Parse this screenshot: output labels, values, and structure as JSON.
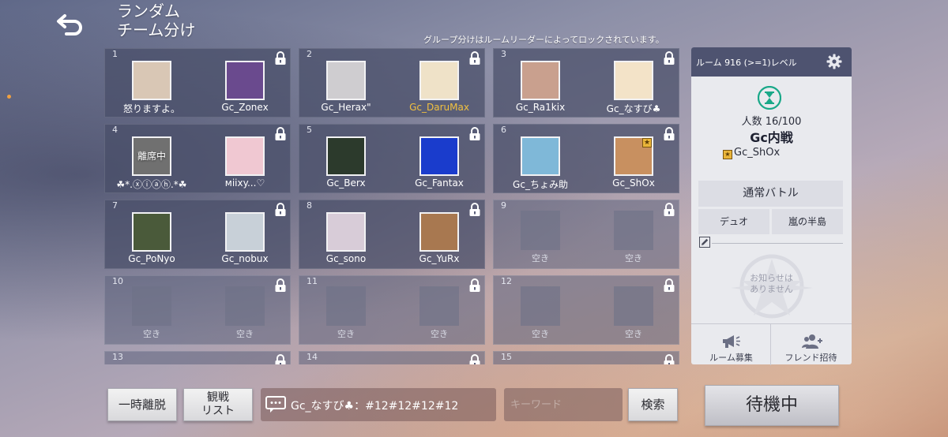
{
  "header": {
    "title_line1": "ランダム",
    "title_line2": "チーム分け",
    "lock_notice": "グループ分けはルームリーダーによってロックされています。"
  },
  "icons": {
    "back": "back-arrow-icon",
    "lock": "lock-icon",
    "gear": "gear-icon",
    "hourglass": "hourglass-icon",
    "edit": "edit-icon",
    "chat": "chat-bubble-icon",
    "megaphone": "megaphone-icon",
    "friend_add": "add-friend-icon"
  },
  "colors": {
    "leader_name": "#f0c040",
    "panel_header": "#4e5370",
    "hourglass": "#19a888"
  },
  "groups": [
    {
      "num": "1",
      "members": [
        {
          "name": "怒りますよ。",
          "color": "#d9c7b5"
        },
        {
          "name": "Gc_Zonex",
          "color": "#6a4a8e"
        }
      ]
    },
    {
      "num": "2",
      "members": [
        {
          "name": "Gc_Herax\"",
          "color": "#cfcdd0"
        },
        {
          "name": "Gc_DaruMax",
          "color": "#efe2c8",
          "leader": true
        }
      ]
    },
    {
      "num": "3",
      "members": [
        {
          "name": "Gc_Ra1kix",
          "color": "#c9a08e"
        },
        {
          "name": "Gc_なすび♣",
          "color": "#f3e3c8"
        }
      ]
    },
    {
      "num": "4",
      "members": [
        {
          "name": "☘*.ⓧⓘⓐⓗ.*☘",
          "color": "#707070",
          "overlay": "離席中"
        },
        {
          "name": "ᴍiixy...♡",
          "color": "#f0c8d2"
        }
      ]
    },
    {
      "num": "5",
      "members": [
        {
          "name": "Gc_Berx",
          "color": "#2c3a2c"
        },
        {
          "name": "Gc_Fantax",
          "color": "#1a3ccc"
        }
      ]
    },
    {
      "num": "6",
      "members": [
        {
          "name": "Gc_ちょみ助",
          "color": "#7fb8d8"
        },
        {
          "name": "Gc_ShOx",
          "color": "#c89060",
          "star": true
        }
      ]
    },
    {
      "num": "7",
      "members": [
        {
          "name": "Gc_PoNyo",
          "color": "#4a5a3a"
        },
        {
          "name": "Gc_nobux",
          "color": "#c8d0d8"
        }
      ]
    },
    {
      "num": "8",
      "members": [
        {
          "name": "Gc_sono",
          "color": "#d8ccd8"
        },
        {
          "name": "Gc_YuRx",
          "color": "#a87850"
        }
      ]
    },
    {
      "num": "9",
      "members": [
        {
          "name": "空き",
          "empty": true
        },
        {
          "name": "空き",
          "empty": true
        }
      ]
    },
    {
      "num": "10",
      "members": [
        {
          "name": "空き",
          "empty": true
        },
        {
          "name": "空き",
          "empty": true
        }
      ]
    },
    {
      "num": "11",
      "members": [
        {
          "name": "空き",
          "empty": true
        },
        {
          "name": "空き",
          "empty": true
        }
      ]
    },
    {
      "num": "12",
      "members": [
        {
          "name": "空き",
          "empty": true
        },
        {
          "name": "空き",
          "empty": true
        }
      ]
    },
    {
      "num": "13",
      "members": []
    },
    {
      "num": "14",
      "members": []
    },
    {
      "num": "15",
      "members": []
    }
  ],
  "room": {
    "label": "ルーム 916 (>=1)レベル",
    "count": "人数 16/100",
    "name": "Gc内戦",
    "host": "Gc_ShOx",
    "mode": "通常バトル",
    "type": "デュオ",
    "map": "嵐の半島",
    "notice": "お知らせは\nありません",
    "recruit_label": "ルーム募集",
    "invite_label": "フレンド招待"
  },
  "bottom": {
    "leave_label": "一時離脱",
    "spectate_line1": "観戦",
    "spectate_line2": "リスト",
    "chat_message": "Gc_なすび♣：#12#12#12#12",
    "search_placeholder": "キーワード",
    "search_label": "検索",
    "wait_label": "待機中"
  }
}
